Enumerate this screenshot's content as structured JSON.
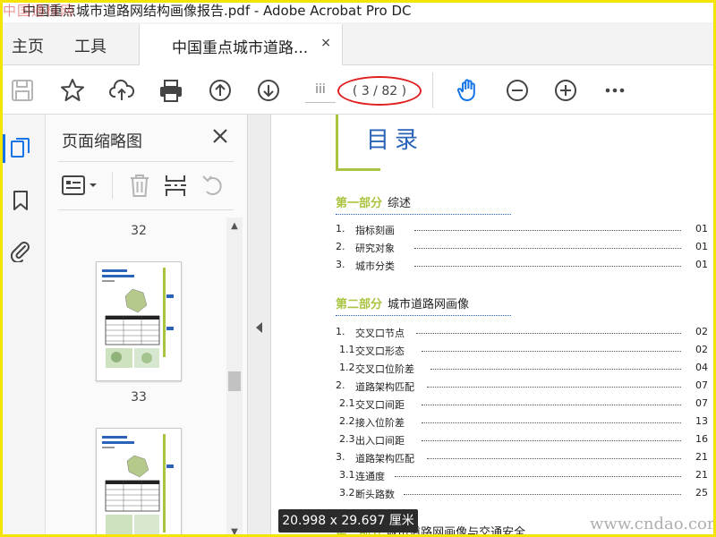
{
  "window": {
    "title": "中国重点城市道路网结构画像报告.pdf - Adobe Acrobat Pro DC",
    "watermark_top": "中国通标网"
  },
  "menu": {
    "home": "主页",
    "tools": "工具"
  },
  "tab": {
    "label": "中国重点城市道路...",
    "close": "×"
  },
  "toolbar": {
    "page_input": "iii",
    "page_indicator": "( 3 / 82 )",
    "icons": [
      "save-icon",
      "star-icon",
      "cloud-upload-icon",
      "print-icon",
      "prev-page-icon",
      "next-page-icon",
      "hand-icon",
      "zoom-out-icon",
      "zoom-in-icon",
      "more-icon"
    ],
    "colors": {
      "hand_active": "#1473e6",
      "annotation": "#e02020"
    }
  },
  "thumbnail_panel": {
    "title": "页面缩略图",
    "close": "×",
    "pages": [
      {
        "number": "32"
      },
      {
        "number": "33"
      }
    ]
  },
  "document": {
    "toc_title": "目录",
    "accent_color": "#a9c441",
    "title_color": "#2a63b8",
    "sections": [
      {
        "num": "第一部分",
        "name": "综述",
        "entries": [
          {
            "idx": "1.",
            "text": "指标刻画",
            "page": "01"
          },
          {
            "idx": "2.",
            "text": "研究对象",
            "page": "01"
          },
          {
            "idx": "3.",
            "text": "城市分类",
            "page": "01"
          }
        ]
      },
      {
        "num": "第二部分",
        "name": "城市道路网画像",
        "entries": [
          {
            "idx": "1.",
            "text": "交叉口节点",
            "page": "02"
          },
          {
            "idx": "1.1",
            "text": "交叉口形态",
            "page": "02"
          },
          {
            "idx": "1.2",
            "text": "交叉口位阶差",
            "page": "04"
          },
          {
            "idx": "2.",
            "text": "道路架构匹配",
            "page": "07"
          },
          {
            "idx": "2.1",
            "text": "交叉口间距",
            "page": "07"
          },
          {
            "idx": "2.2",
            "text": "接入位阶差",
            "page": "13"
          },
          {
            "idx": "2.3",
            "text": "出入口间距",
            "page": "16"
          },
          {
            "idx": "3.",
            "text": "道路架构匹配",
            "page": "21"
          },
          {
            "idx": "3.1",
            "text": "连通度",
            "page": "21"
          },
          {
            "idx": "3.2",
            "text": "断头路数",
            "page": "25"
          }
        ]
      }
    ],
    "bottom_heading_num": "第三部分",
    "bottom_heading_text": "城市道路网画像与交通安全"
  },
  "tooltip": "20.998 x 29.697 厘米",
  "watermark_bottom": "www.cndao.com"
}
